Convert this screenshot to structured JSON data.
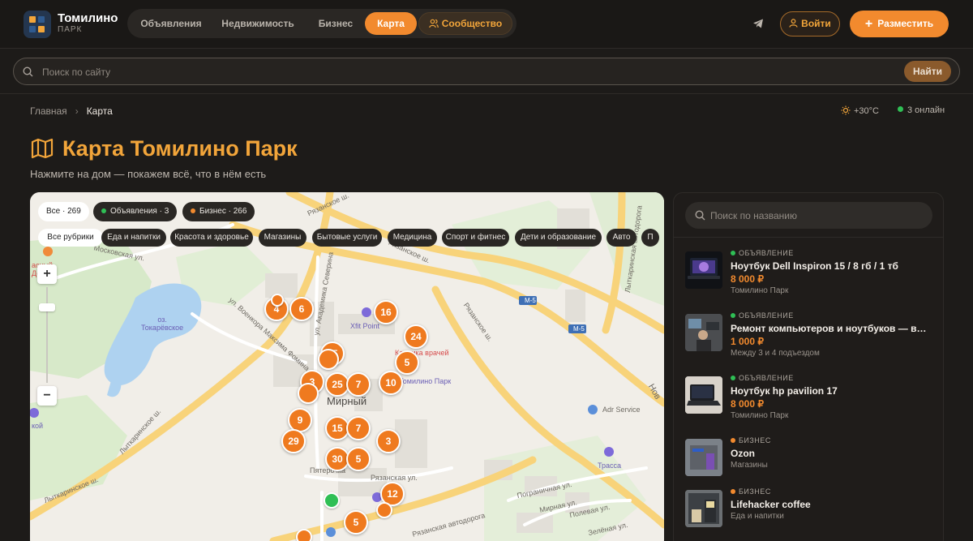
{
  "header": {
    "brand_name": "Томилино",
    "brand_sub": "ПАРК",
    "nav": [
      "Объявления",
      "Недвижимость",
      "Бизнес",
      "Карта",
      "Сообщество"
    ],
    "login_label": "Войти",
    "post_label": "Разместить"
  },
  "search": {
    "placeholder": "Поиск по сайту",
    "button": "Найти"
  },
  "breadcrumbs": {
    "home": "Главная",
    "current": "Карта"
  },
  "status": {
    "weather": "+30°C",
    "online": "3 онлайн"
  },
  "page": {
    "title": "Карта Томилино Парк",
    "subtitle": "Нажмите на дом — покажем всё, что в нём есть"
  },
  "map": {
    "filters": {
      "all": "Все · 269",
      "ads": "Объявления · 3",
      "business": "Бизнес · 266"
    },
    "categories": [
      "Все рубрики",
      "Еда и напитки",
      "Красота и здоровье",
      "Магазины",
      "Бытовые услуги",
      "Медицина",
      "Спорт и фитнес",
      "Дети и образование",
      "Авто",
      "П"
    ],
    "clusters": [
      "4",
      "6",
      "16",
      "15",
      "24",
      "5",
      "3",
      "25",
      "7",
      "10",
      "9",
      "15",
      "7",
      "29",
      "3",
      "30",
      "5",
      "12",
      "5"
    ],
    "labels": {
      "moskovskaya": "Московская ул.",
      "lake": "оз.\nТокарёвское",
      "ryazanskoe1": "Рязанское ш.",
      "ryazanskoe2": "Рязанское ш.",
      "ryazanskoe3": "Рязанское ш.",
      "akademika": "ул. Академика Северина",
      "voenkor": "ул. Военкора Максима Фомина",
      "lytkarinskoe1": "Лыткаринское ш.",
      "lytkarinskoe2": "Лыткаринское ш.",
      "lytkarinskoe3": "Лыткаринское ш.",
      "avtodoroga": "Лыткаринская автодорога",
      "mirny": "Мирный",
      "tomilino_park": "Томилино Парк",
      "xfit": "Xfit Point",
      "clinic": "Клиника врачей\nиковых",
      "adr": "Adr Service",
      "trassa": "Трасса",
      "pyaterochka": "Пятерочка",
      "ryazanskaya_ul": "Рязанская ул.",
      "pogranichnaya": "Пограничная ул.",
      "mirnaya": "Мирная ул.",
      "polevaya": "Полевая ул.",
      "zelenaya": "Зелёная ул.",
      "ryazanskaya_avt": "Рязанская автодорога",
      "m5a": "М-5",
      "m5b": "М-5",
      "nov": "Нов",
      "kray": "кой",
      "krasny": "асный\nДом"
    }
  },
  "sidebar": {
    "search_placeholder": "Поиск по названию",
    "items": [
      {
        "kind": "ОБЪЯВЛЕНИЕ",
        "name": "Ноутбук Dell Inspiron 15 / 8 гб / 1 тб",
        "price": "8 000 ₽",
        "location": "Томилино Парк"
      },
      {
        "kind": "ОБЪЯВЛЕНИЕ",
        "name": "Ремонт компьютеров и ноутбуков — выезд на дом",
        "price": "1 000 ₽",
        "location": "Между 3 и 4 подъездом"
      },
      {
        "kind": "ОБЪЯВЛЕНИЕ",
        "name": "Ноутбук hp pavilion 17",
        "price": "8 000 ₽",
        "location": "Томилино Парк"
      },
      {
        "kind": "БИЗНЕС",
        "name": "Ozon",
        "location": "Магазины"
      },
      {
        "kind": "БИЗНЕС",
        "name": "Lifehacker coffee",
        "location": "Еда и напитки"
      }
    ]
  },
  "colors": {
    "accent": "#f28a2e",
    "ad_dot": "#2fbf55",
    "business_dot": "#f28a2e",
    "background": "#1d1b19"
  },
  "icons": [
    "map-icon",
    "telegram-icon",
    "user-icon",
    "plus-icon",
    "search-icon",
    "sun-icon",
    "community-icon"
  ]
}
